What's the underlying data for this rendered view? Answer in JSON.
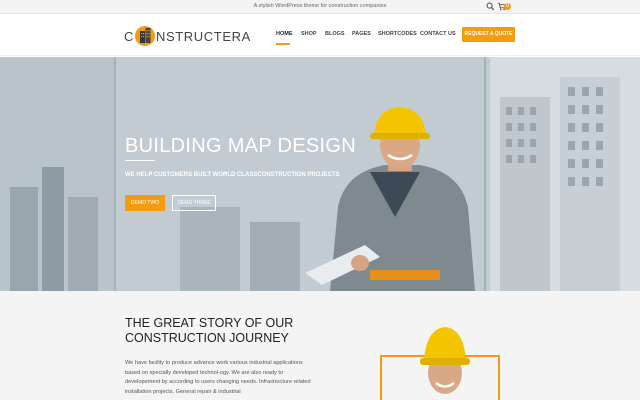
{
  "topbar": {
    "tagline": "A stylish WordPress theme for construction companies",
    "icons": [
      "search-icon",
      "cart-icon"
    ],
    "cart_count": "0"
  },
  "header": {
    "logo_prefix": "C",
    "logo_main": "NSTRUCT",
    "logo_highlight": "ERA",
    "nav": [
      "HOME",
      "SHOP",
      "BLOGS",
      "PAGES",
      "SHORTCODES",
      "CONTACT US"
    ],
    "active_nav": "HOME",
    "cta": "REQUEST A QUOTE"
  },
  "hero": {
    "title": "BUILDING MAP DESIGN",
    "subtitle": "WE HELP CUSTOMERS BUILT WORLD CLASSCONSTRUCTION PROJECTS",
    "button_primary": "DEMO TWO",
    "button_secondary": "DEMO THREE"
  },
  "story": {
    "title": "THE GREAT STORY OF OUR CONSTRUCTION JOURNEY",
    "text": "We have facility to produce advance work various industrial applications based on specially developed technol-ogy. We are also ready to developement by according to users changing needs. Infrastructure related installation projects. General repair & industrial"
  },
  "colors": {
    "accent": "#f39c12",
    "text_dark": "#222222",
    "topbar_bg": "#f3f3f3",
    "section_bg": "#f4f4f4"
  }
}
